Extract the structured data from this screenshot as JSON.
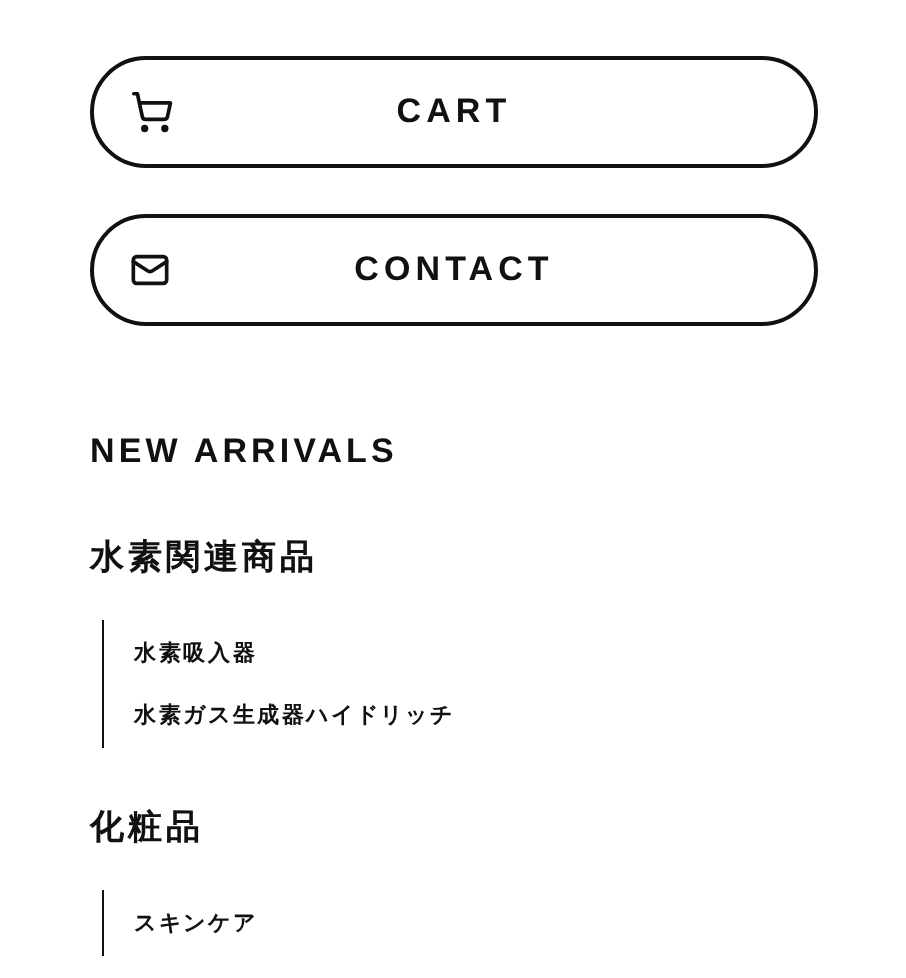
{
  "buttons": [
    {
      "label": "CART",
      "kind": "cart"
    },
    {
      "label": "CONTACT",
      "kind": "contact"
    }
  ],
  "new_arrivals": {
    "title": "NEW ARRIVALS",
    "categories": [
      {
        "label": "水素関連商品",
        "children": [
          {
            "label": "水素吸入器"
          },
          {
            "label": "水素ガス生成器ハイドリッチ"
          }
        ]
      },
      {
        "label": "化粧品",
        "children": [
          {
            "label": "スキンケア"
          }
        ]
      }
    ]
  }
}
